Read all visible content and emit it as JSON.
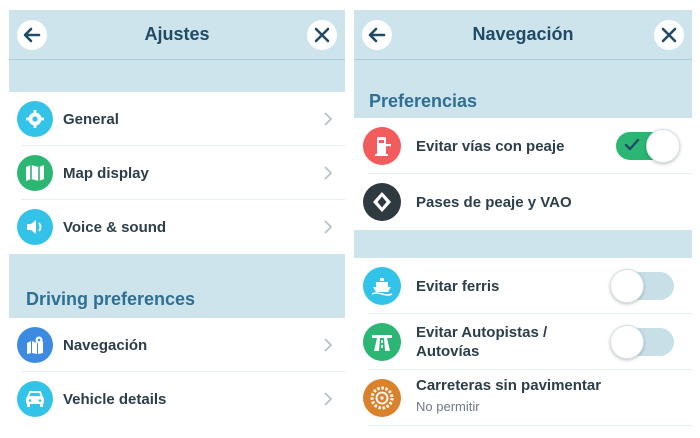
{
  "left_panel": {
    "title": "Ajustes",
    "items": [
      {
        "label": "General",
        "icon": "gear-icon",
        "color": "#33c3e8"
      },
      {
        "label": "Map display",
        "icon": "map-icon",
        "color": "#2bb673"
      },
      {
        "label": "Voice & sound",
        "icon": "speaker-icon",
        "color": "#33c3e8"
      }
    ],
    "section_title": "Driving preferences",
    "driving_items": [
      {
        "label": "Navegación",
        "icon": "navigation-map-icon",
        "color": "#3d8be0"
      },
      {
        "label": "Vehicle details",
        "icon": "car-icon",
        "color": "#33c3e8"
      }
    ]
  },
  "right_panel": {
    "title": "Navegación",
    "section_title": "Preferencias",
    "items": [
      {
        "label": "Evitar vías con peaje",
        "icon": "toll-icon",
        "color": "#f25c5c",
        "toggle": true
      },
      {
        "label": "Pases de peaje y VAO",
        "icon": "diamond-icon",
        "color": "#2f3a40"
      }
    ],
    "avoid_items": [
      {
        "label": "Evitar ferris",
        "icon": "ferry-icon",
        "color": "#33c3e8",
        "toggle": false
      },
      {
        "label_line1": "Evitar Autopistas /",
        "label_line2": "Autovías",
        "icon": "highway-icon",
        "color": "#2bb673",
        "toggle": false
      },
      {
        "label": "Carreteras sin pavimentar",
        "sublabel": "No permitir",
        "icon": "wheel-icon",
        "color": "#d9822b"
      }
    ]
  },
  "colors": {
    "header_bg": "#cde4ec",
    "title_text": "#1f4b66",
    "section_text": "#2e6f93",
    "toggle_on": "#2bb673",
    "toggle_off": "#c8dfe8"
  }
}
